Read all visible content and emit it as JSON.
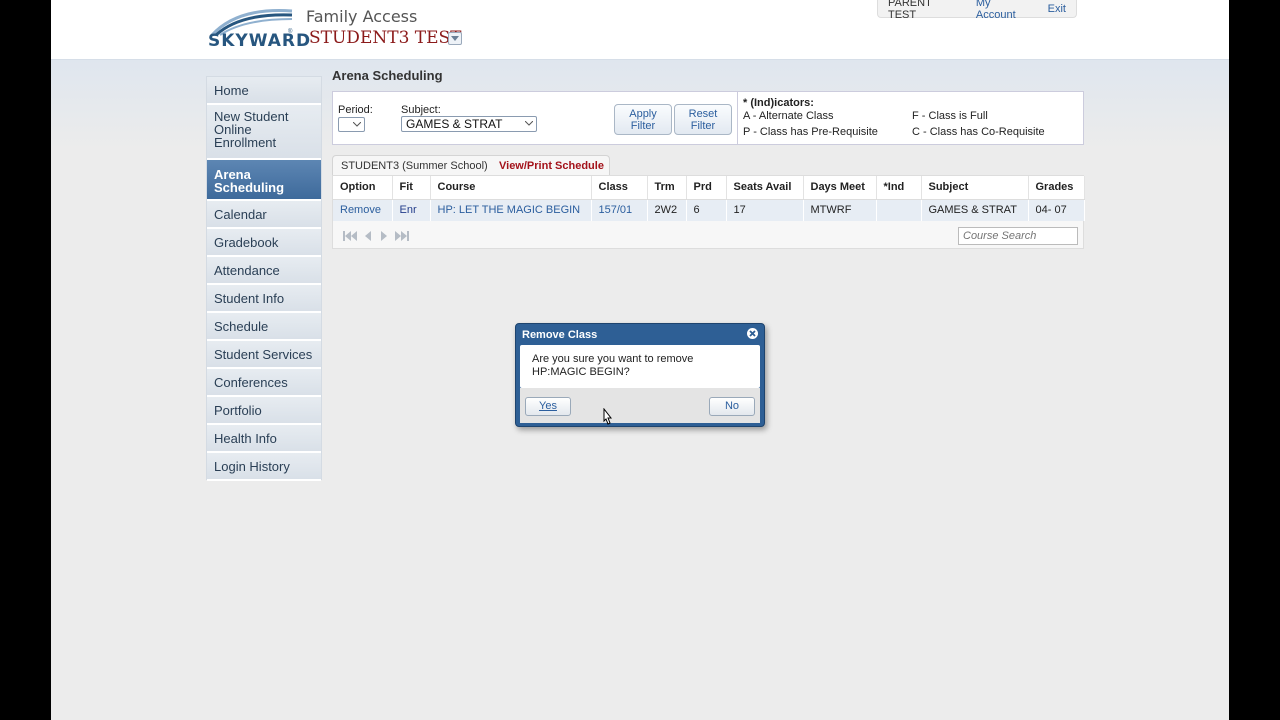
{
  "header": {
    "logo_text": "SKYWARD",
    "app_title": "Family Access",
    "student_name": "STUDENT3 TEST",
    "user_name": "PARENT TEST",
    "my_account": "My Account",
    "exit": "Exit"
  },
  "sidebar": {
    "items": [
      {
        "label": "Home"
      },
      {
        "label": "New Student Online Enrollment"
      },
      {
        "label": "Arena Scheduling",
        "active": true
      },
      {
        "label": "Calendar"
      },
      {
        "label": "Gradebook"
      },
      {
        "label": "Attendance"
      },
      {
        "label": "Student Info"
      },
      {
        "label": "Schedule"
      },
      {
        "label": "Student Services"
      },
      {
        "label": "Conferences"
      },
      {
        "label": "Portfolio"
      },
      {
        "label": "Health Info"
      },
      {
        "label": "Login History"
      }
    ]
  },
  "main": {
    "page_title": "Arena Scheduling",
    "filter": {
      "period_label": "Period:",
      "period_value": "",
      "subject_label": "Subject:",
      "subject_value": "GAMES & STRAT",
      "apply_line1": "Apply",
      "apply_line2": "Filter",
      "reset_line1": "Reset",
      "reset_line2": "Filter"
    },
    "indicators": {
      "title": "* (Ind)icators:",
      "a": "A - Alternate Class",
      "f": "F - Class is Full",
      "p": "P - Class has Pre-Requisite",
      "c": "C - Class has Co-Requisite"
    },
    "tabs": {
      "student": "STUDENT3 (Summer School)",
      "print": "View/Print Schedule"
    },
    "table": {
      "headers": [
        "Option",
        "Fit",
        "Course",
        "Class",
        "Trm",
        "Prd",
        "Seats Avail",
        "Days Meet",
        "*Ind",
        "Subject",
        "Grades"
      ],
      "rows": [
        {
          "option": "Remove",
          "fit": "Enr",
          "course": "HP: LET THE MAGIC BEGIN",
          "class": "157/01",
          "trm": "2W2",
          "prd": "6",
          "seats": "17",
          "days": "MTWRF",
          "ind": "",
          "subject": "GAMES & STRAT",
          "grades": "04- 07"
        }
      ]
    },
    "course_search_placeholder": "Course Search"
  },
  "dialog": {
    "title": "Remove Class",
    "message": "Are you sure you want to remove HP:MAGIC BEGIN?",
    "yes": "Yes",
    "no": "No"
  },
  "colors": {
    "accent": "#2e5f95",
    "link": "#2b5e9e",
    "student_name": "#8b1a1a",
    "print_link": "#a3121a"
  }
}
